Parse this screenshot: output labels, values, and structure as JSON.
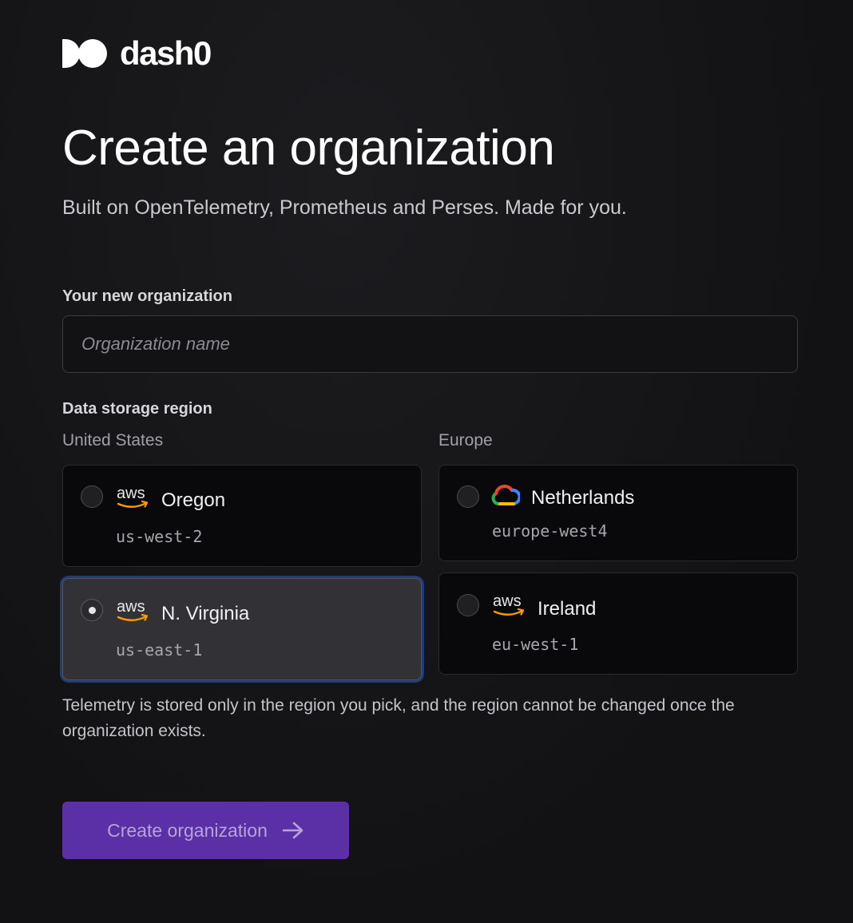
{
  "brand": {
    "name": "dash0",
    "colors": {
      "accent": "#5b30a6",
      "selected_ring": "#1f3d78",
      "background": "#121214"
    }
  },
  "header": {
    "title": "Create an organization",
    "subtitle": "Built on OpenTelemetry, Prometheus and Perses. Made for you."
  },
  "form": {
    "org_label": "Your new organization",
    "org_name_placeholder": "Organization name",
    "org_name_value": "",
    "region_label": "Data storage region",
    "groups": {
      "us": {
        "label": "United States",
        "regions": [
          {
            "provider": "aws",
            "provider_icon": "aws-logo-icon",
            "name": "Oregon",
            "code": "us-west-2",
            "selected": false
          },
          {
            "provider": "aws",
            "provider_icon": "aws-logo-icon",
            "name": "N. Virginia",
            "code": "us-east-1",
            "selected": true
          }
        ]
      },
      "eu": {
        "label": "Europe",
        "regions": [
          {
            "provider": "gcp",
            "provider_icon": "google-cloud-icon",
            "name": "Netherlands",
            "code": "europe-west4",
            "selected": false
          },
          {
            "provider": "aws",
            "provider_icon": "aws-logo-icon",
            "name": "Ireland",
            "code": "eu-west-1",
            "selected": false
          }
        ]
      }
    },
    "note": "Telemetry is stored only in the region you pick, and the region cannot be changed once the organization exists.",
    "submit_label": "Create organization",
    "submit_icon": "arrow-right-icon"
  }
}
